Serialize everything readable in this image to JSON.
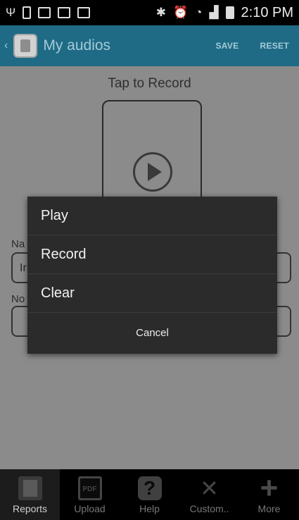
{
  "status_bar": {
    "time": "2:10 PM",
    "icons": [
      "usb-icon",
      "battery-saver-icon",
      "image-icon",
      "voicemail-icon",
      "gmail-icon",
      "bluetooth-icon",
      "alarm-icon",
      "wifi-icon",
      "signal-icon",
      "battery-icon"
    ]
  },
  "action_bar": {
    "title": "My audios",
    "save_label": "SAVE",
    "reset_label": "RESET",
    "color": "#1f6b86"
  },
  "main": {
    "tap_label": "Tap to Record",
    "name_label": "Na",
    "name_value": "Ir",
    "notes_label": "No"
  },
  "dialog": {
    "items": [
      "Play",
      "Record",
      "Clear"
    ],
    "cancel_label": "Cancel"
  },
  "bottom_nav": {
    "items": [
      {
        "label": "Reports",
        "icon": "reports-icon"
      },
      {
        "label": "Upload",
        "icon": "pdf-icon"
      },
      {
        "label": "Help",
        "icon": "help-icon"
      },
      {
        "label": "Custom..",
        "icon": "tools-icon"
      },
      {
        "label": "More",
        "icon": "plus-icon"
      }
    ]
  }
}
